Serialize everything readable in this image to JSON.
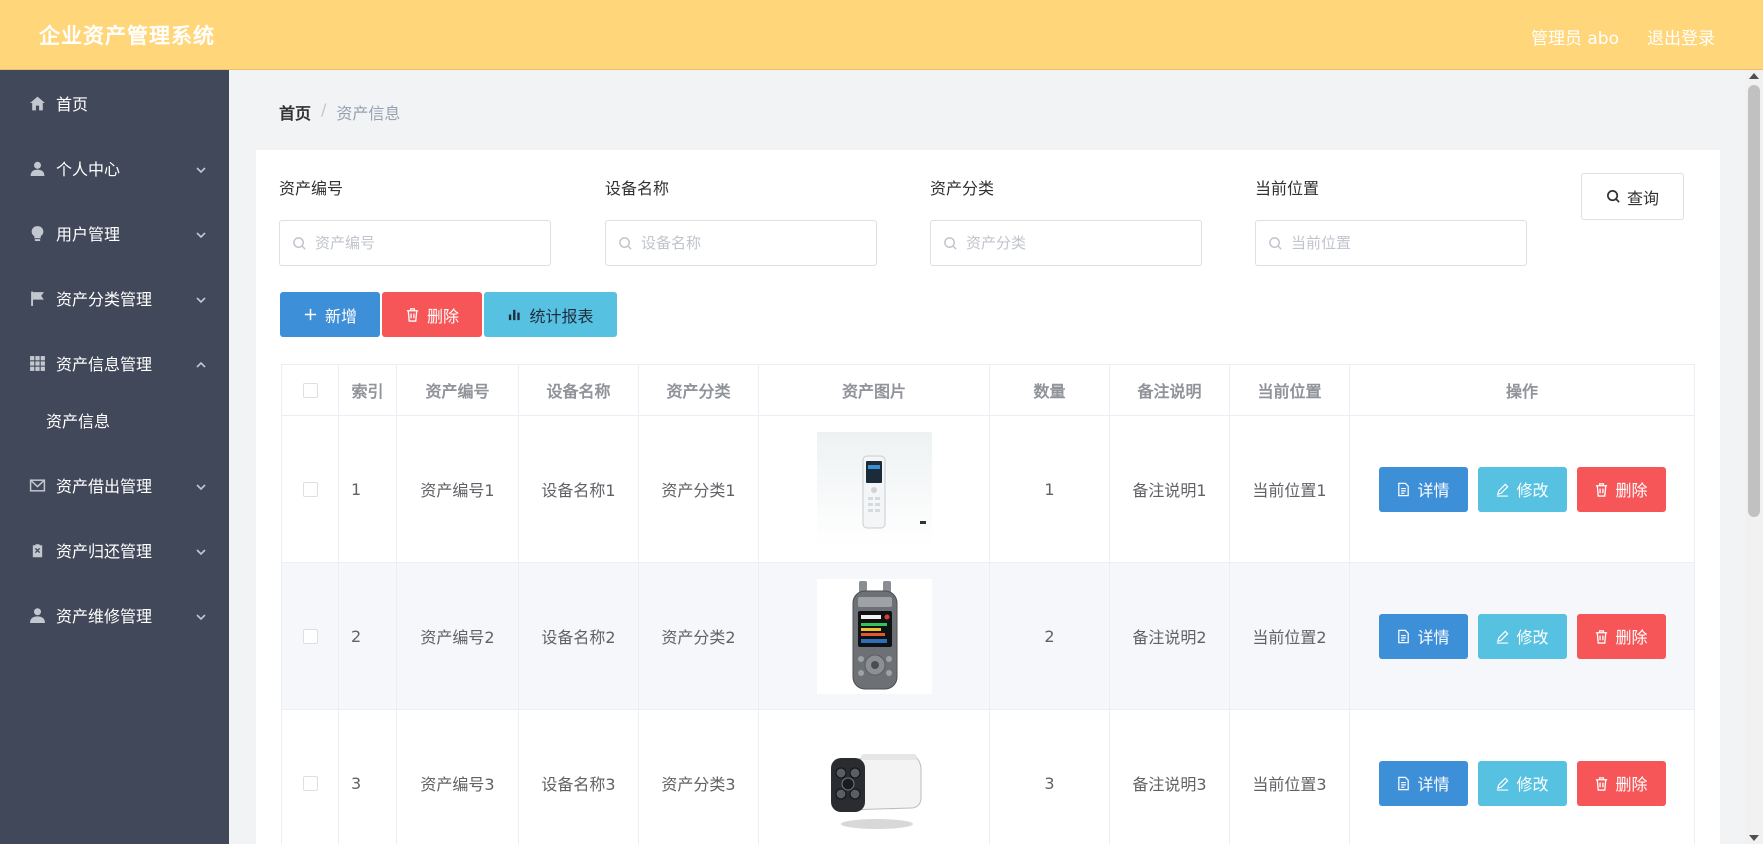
{
  "header": {
    "title": "企业资产管理系统",
    "user_label": "管理员 abo",
    "logout_label": "退出登录"
  },
  "sidebar": {
    "items": [
      {
        "label": "首页",
        "icon": "home-icon"
      },
      {
        "label": "个人中心",
        "icon": "user-icon"
      },
      {
        "label": "用户管理",
        "icon": "lightbulb-icon"
      },
      {
        "label": "资产分类管理",
        "icon": "flag-icon"
      },
      {
        "label": "资产信息管理",
        "icon": "grid-icon"
      },
      {
        "label": "资产借出管理",
        "icon": "mail-icon"
      },
      {
        "label": "资产归还管理",
        "icon": "clipboard-icon"
      },
      {
        "label": "资产维修管理",
        "icon": "person-icon"
      }
    ],
    "submenu": {
      "label": "资产信息"
    }
  },
  "breadcrumb": {
    "home": "首页",
    "separator": "/",
    "current": "资产信息"
  },
  "search": {
    "fields": [
      {
        "label": "资产编号",
        "placeholder": "资产编号"
      },
      {
        "label": "设备名称",
        "placeholder": "设备名称"
      },
      {
        "label": "资产分类",
        "placeholder": "资产分类"
      },
      {
        "label": "当前位置",
        "placeholder": "当前位置"
      }
    ],
    "query_label": "查询"
  },
  "actions": {
    "add_label": "新增",
    "delete_label": "删除",
    "report_label": "统计报表"
  },
  "table": {
    "headers": [
      "索引",
      "资产编号",
      "设备名称",
      "资产分类",
      "资产图片",
      "数量",
      "备注说明",
      "当前位置",
      "操作"
    ],
    "rows": [
      {
        "index": "1",
        "code": "资产编号1",
        "name": "设备名称1",
        "category": "资产分类1",
        "image": "voice-recorder-white",
        "qty": "1",
        "note": "备注说明1",
        "location": "当前位置1"
      },
      {
        "index": "2",
        "code": "资产编号2",
        "name": "设备名称2",
        "category": "资产分类2",
        "image": "audio-recorder-grey",
        "qty": "2",
        "note": "备注说明2",
        "location": "当前位置2"
      },
      {
        "index": "3",
        "code": "资产编号3",
        "name": "设备名称3",
        "category": "资产分类3",
        "image": "security-camera",
        "qty": "3",
        "note": "备注说明3",
        "location": "当前位置3"
      }
    ],
    "ops": {
      "detail": "详情",
      "edit": "修改",
      "delete": "删除"
    }
  },
  "colors": {
    "header": "#ffd67a",
    "sidebar": "#404859",
    "primary": "#3d8fd8",
    "info": "#57c1e2",
    "danger": "#f75658"
  }
}
